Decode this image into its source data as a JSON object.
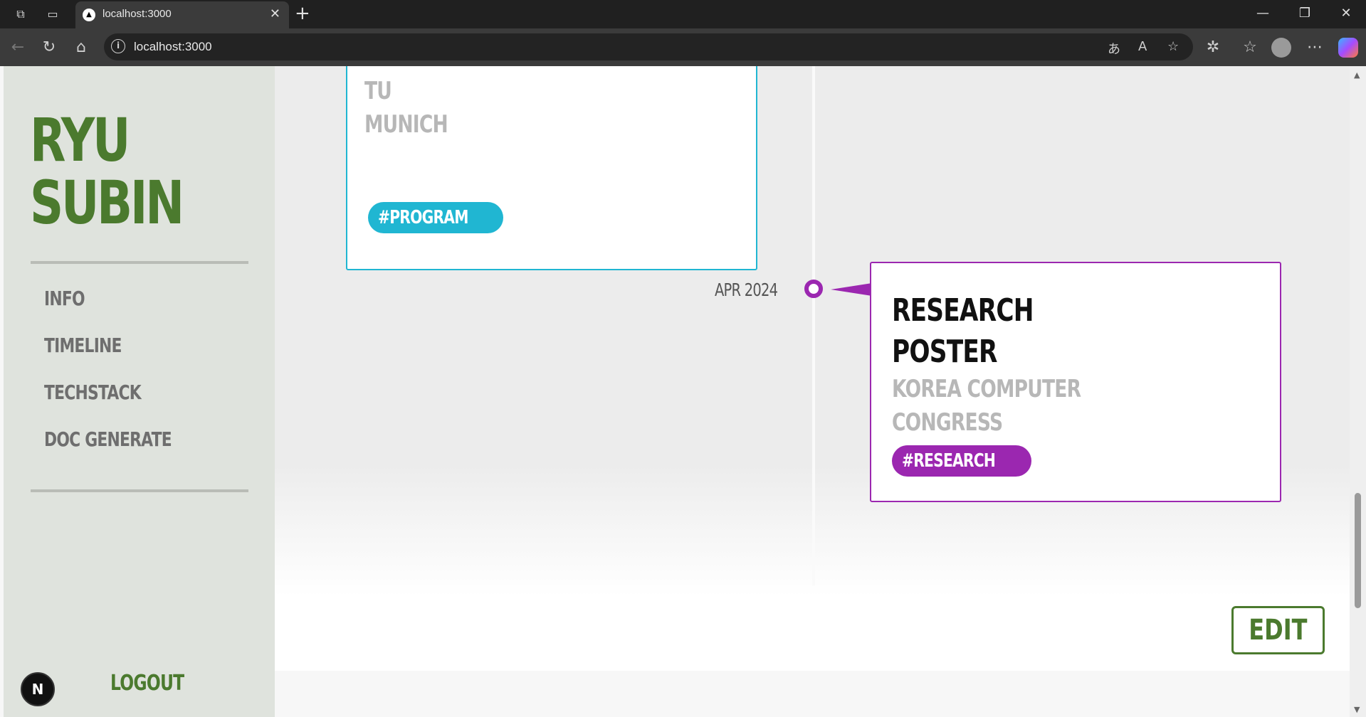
{
  "browser": {
    "tab_title": "localhost:3000",
    "url": "localhost:3000",
    "tab_favicon": "▲",
    "icons": [
      "workspaces-icon",
      "tab-actions-icon",
      "back-icon",
      "reload-icon",
      "home-icon",
      "site-info-icon",
      "translate-icon",
      "read-aloud-icon",
      "favorite-icon",
      "extensions-icon",
      "favorites-icon",
      "profile-icon",
      "more-icon",
      "copilot-icon"
    ]
  },
  "sidebar": {
    "logo_line1": "RYU",
    "logo_line2": "SUBIN",
    "nav": [
      "INFO",
      "TIMELINE",
      "TECHSTACK",
      "DOC GENERATE"
    ],
    "logout": "LOGOUT",
    "badge": "N"
  },
  "timeline": {
    "cards": [
      {
        "title_fragment": "",
        "subtitle_lines": [
          "TU",
          "MUNICH"
        ],
        "tag": "#PROGRAM",
        "color": "#20b6d2"
      },
      {
        "date": "APR 2024",
        "title_lines": [
          "RESEARCH",
          "POSTER"
        ],
        "subtitle_lines": [
          "KOREA COMPUTER",
          "CONGRESS"
        ],
        "tag": "#RESEARCH",
        "color": "#9b27b0"
      }
    ]
  },
  "actions": {
    "edit": "EDIT"
  },
  "colors": {
    "accent_green": "#4b7a2e",
    "program": "#20b6d2",
    "research": "#9b27b0"
  }
}
